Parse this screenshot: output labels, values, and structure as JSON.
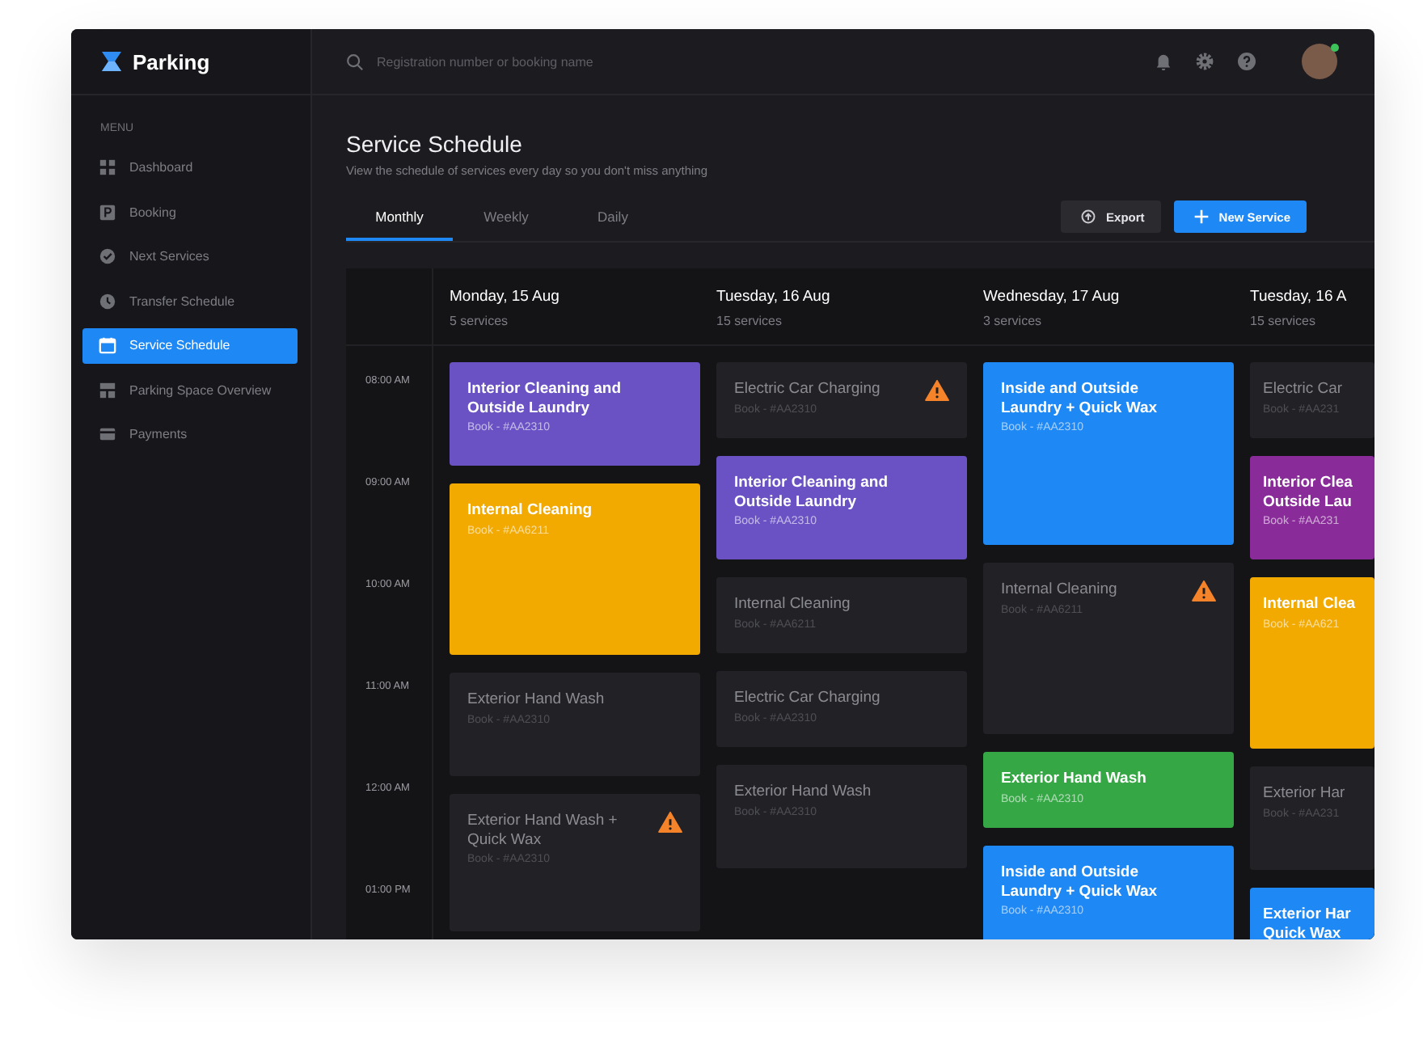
{
  "app": {
    "name": "Parking"
  },
  "sidebar": {
    "heading": "MENU",
    "items": [
      {
        "label": "Dashboard",
        "selected": false
      },
      {
        "label": "Booking",
        "selected": false
      },
      {
        "label": "Next Services",
        "selected": false
      },
      {
        "label": "Transfer Schedule",
        "selected": false
      },
      {
        "label": "Service Schedule",
        "selected": true
      },
      {
        "label": "Parking Space Overview",
        "selected": false
      },
      {
        "label": "Payments",
        "selected": false
      }
    ]
  },
  "search": {
    "placeholder": "Registration number or booking name"
  },
  "page": {
    "title": "Service Schedule",
    "subtitle": "View the schedule of services every day so you don't miss anything"
  },
  "tabs": [
    {
      "label": "Monthly",
      "selected": true
    },
    {
      "label": "Weekly",
      "selected": false
    },
    {
      "label": "Daily",
      "selected": false
    }
  ],
  "buttons": [
    {
      "label": "Export",
      "kind": "secondary"
    },
    {
      "label": "New Service",
      "kind": "primary"
    }
  ],
  "times": [
    "08:00 AM",
    "09:00 AM",
    "10:00 AM",
    "11:00 AM",
    "12:00 AM",
    "01:00 PM"
  ],
  "days": [
    {
      "date": "Monday, 15 Aug",
      "count": "5 services",
      "events": [
        {
          "title": "Interior Cleaning and Outside Laundry",
          "booking": "Book - #AA2310",
          "color": "#6a52c4",
          "muted": false,
          "warning": false
        },
        {
          "title": "Internal Cleaning",
          "booking": "Book - #AA6211",
          "color": "#f2a900",
          "muted": false,
          "warning": false
        },
        {
          "title": "Exterior Hand Wash",
          "booking": "Book - #AA2310",
          "color": "#222226",
          "muted": true,
          "warning": false
        },
        {
          "title": "Exterior Hand Wash + Quick Wax",
          "booking": "Book - #AA2310",
          "color": "#222226",
          "muted": true,
          "warning": true
        }
      ]
    },
    {
      "date": "Tuesday, 16 Aug",
      "count": "15 services",
      "events": [
        {
          "title": "Electric Car Charging",
          "booking": "Book - #AA2310",
          "color": "#222226",
          "muted": true,
          "warning": true
        },
        {
          "title": "Interior Cleaning and Outside Laundry",
          "booking": "Book - #AA2310",
          "color": "#6a52c4",
          "muted": false,
          "warning": false
        },
        {
          "title": "Internal Cleaning",
          "booking": "Book - #AA6211",
          "color": "#222226",
          "muted": true,
          "warning": false
        },
        {
          "title": "Electric Car Charging",
          "booking": "Book - #AA2310",
          "color": "#222226",
          "muted": true,
          "warning": false
        },
        {
          "title": "Exterior Hand Wash",
          "booking": "Book - #AA2310",
          "color": "#222226",
          "muted": true,
          "warning": false
        }
      ]
    },
    {
      "date": "Wednesday, 17 Aug",
      "count": "3 services",
      "events": [
        {
          "title": "Inside and Outside Laundry + Quick Wax",
          "booking": "Book - #AA2310",
          "color": "#1e88f5",
          "muted": false,
          "warning": false
        },
        {
          "title": "Internal Cleaning",
          "booking": "Book - #AA6211",
          "color": "#222226",
          "muted": true,
          "warning": true
        },
        {
          "title": "Exterior Hand Wash",
          "booking": "Book - #AA2310",
          "color": "#35a745",
          "muted": false,
          "warning": false
        },
        {
          "title": "Inside and Outside Laundry + Quick Wax",
          "booking": "Book - #AA2310",
          "color": "#1e88f5",
          "muted": false,
          "warning": false
        }
      ]
    },
    {
      "date": "Tuesday, 16 A",
      "count": "15 services",
      "events": [
        {
          "title": "Electric Car",
          "booking": "Book - #AA231",
          "color": "#222226",
          "muted": true,
          "warning": false
        },
        {
          "title": "Interior Clea\nOutside Lau",
          "booking": "Book - #AA231",
          "color": "#8a2b9a",
          "muted": false,
          "warning": false
        },
        {
          "title": "Internal Clea",
          "booking": "Book - #AA621",
          "color": "#f2a900",
          "muted": false,
          "warning": false
        },
        {
          "title": "Exterior Har",
          "booking": "Book - #AA231",
          "color": "#222226",
          "muted": true,
          "warning": false
        },
        {
          "title": "Exterior Har\nQuick Wax",
          "color": "#1e88f5",
          "muted": false,
          "warning": false
        }
      ]
    }
  ]
}
